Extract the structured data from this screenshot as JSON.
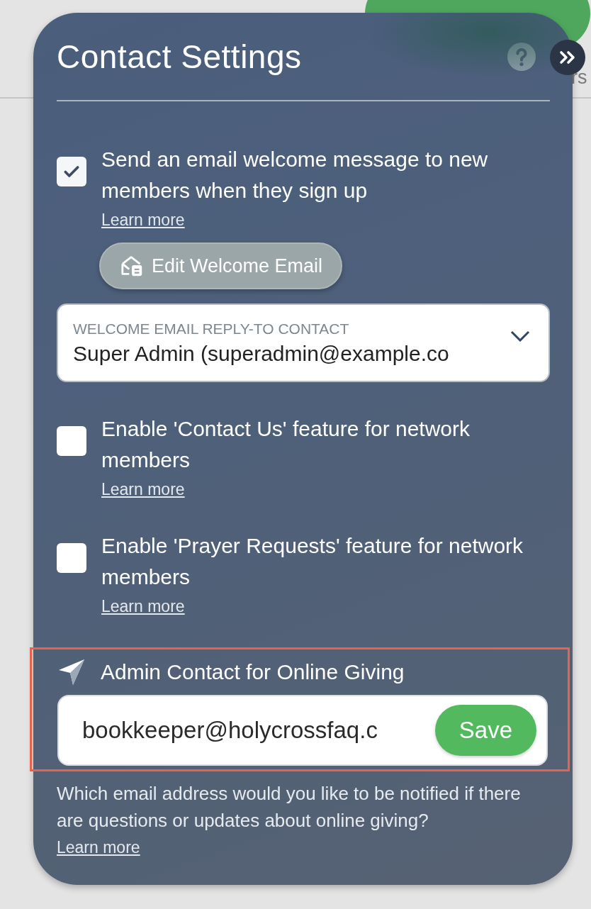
{
  "background": {
    "label": "rs"
  },
  "panel": {
    "title": "Contact Settings"
  },
  "options": [
    {
      "label": "Send an email welcome message to new members when they sign up",
      "checked": true,
      "link": "Learn more",
      "button": "Edit Welcome Email",
      "select": {
        "label": "WELCOME EMAIL REPLY-TO CONTACT",
        "value": "Super Admin (superadmin@example.co"
      }
    },
    {
      "label": "Enable 'Contact Us' feature for network members",
      "checked": false,
      "link": "Learn more"
    },
    {
      "label": "Enable 'Prayer Requests' feature for network members",
      "checked": false,
      "link": "Learn more"
    }
  ],
  "giving": {
    "title": "Admin Contact for Online Giving",
    "value": "bookkeeper@holycrossfaq.c",
    "button": "Save",
    "highlighted": true,
    "help": "Which email address would you like to be notified if there are questions or updates about online giving?",
    "link": "Learn more"
  }
}
